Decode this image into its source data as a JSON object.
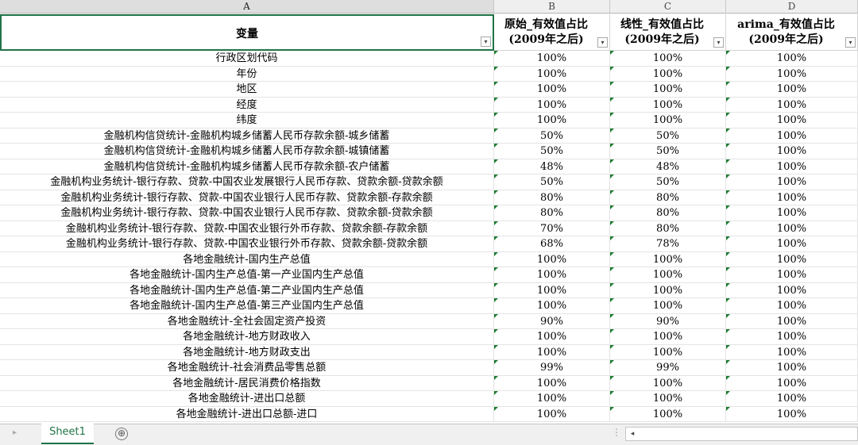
{
  "columns": [
    "A",
    "B",
    "C",
    "D"
  ],
  "header": {
    "a": "变量",
    "b_line1": "原始_有效值占比",
    "b_line2": "(2009年之后)",
    "c_line1": "线性_有效值占比",
    "c_line2": "(2009年之后)",
    "d_line1": "arima_有效值占比",
    "d_line2": "(2009年之后)"
  },
  "rows": [
    [
      "行政区划代码",
      "100%",
      "100%",
      "100%"
    ],
    [
      "年份",
      "100%",
      "100%",
      "100%"
    ],
    [
      "地区",
      "100%",
      "100%",
      "100%"
    ],
    [
      "经度",
      "100%",
      "100%",
      "100%"
    ],
    [
      "纬度",
      "100%",
      "100%",
      "100%"
    ],
    [
      "金融机构信贷统计-金融机构城乡储蓄人民币存款余额-城乡储蓄",
      "50%",
      "50%",
      "100%"
    ],
    [
      "金融机构信贷统计-金融机构城乡储蓄人民币存款余额-城镇储蓄",
      "50%",
      "50%",
      "100%"
    ],
    [
      "金融机构信贷统计-金融机构城乡储蓄人民币存款余额-农户储蓄",
      "48%",
      "48%",
      "100%"
    ],
    [
      "金融机构业务统计-银行存款、贷款-中国农业发展银行人民币存款、贷款余额-贷款余额",
      "50%",
      "50%",
      "100%"
    ],
    [
      "金融机构业务统计-银行存款、贷款-中国农业银行人民币存款、贷款余额-存款余额",
      "80%",
      "80%",
      "100%"
    ],
    [
      "金融机构业务统计-银行存款、贷款-中国农业银行人民币存款、贷款余额-贷款余额",
      "80%",
      "80%",
      "100%"
    ],
    [
      "金融机构业务统计-银行存款、贷款-中国农业银行外币存款、贷款余额-存款余额",
      "70%",
      "80%",
      "100%"
    ],
    [
      "金融机构业务统计-银行存款、贷款-中国农业银行外币存款、贷款余额-贷款余额",
      "68%",
      "78%",
      "100%"
    ],
    [
      "各地金融统计-国内生产总值",
      "100%",
      "100%",
      "100%"
    ],
    [
      "各地金融统计-国内生产总值-第一产业国内生产总值",
      "100%",
      "100%",
      "100%"
    ],
    [
      "各地金融统计-国内生产总值-第二产业国内生产总值",
      "100%",
      "100%",
      "100%"
    ],
    [
      "各地金融统计-国内生产总值-第三产业国内生产总值",
      "100%",
      "100%",
      "100%"
    ],
    [
      "各地金融统计-全社会固定资产投资",
      "90%",
      "90%",
      "100%"
    ],
    [
      "各地金融统计-地方财政收入",
      "100%",
      "100%",
      "100%"
    ],
    [
      "各地金融统计-地方财政支出",
      "100%",
      "100%",
      "100%"
    ],
    [
      "各地金融统计-社会消费品零售总额",
      "99%",
      "99%",
      "100%"
    ],
    [
      "各地金融统计-居民消费价格指数",
      "100%",
      "100%",
      "100%"
    ],
    [
      "各地金融统计-进出口总额",
      "100%",
      "100%",
      "100%"
    ],
    [
      "各地金融统计-进出口总额-进口",
      "100%",
      "100%",
      "100%"
    ]
  ],
  "sheet_tab": "Sheet1",
  "add_sheet_symbol": "⊕",
  "filter_symbol": "▾",
  "filter_active_symbol": "▾",
  "scroll_left_symbol": "◂",
  "nav_symbol": "▸",
  "dots_symbol": "⋮",
  "colors": {
    "accent": "#217346",
    "green_triangle": "#1e7d32",
    "grid": "#e4e4e4"
  }
}
